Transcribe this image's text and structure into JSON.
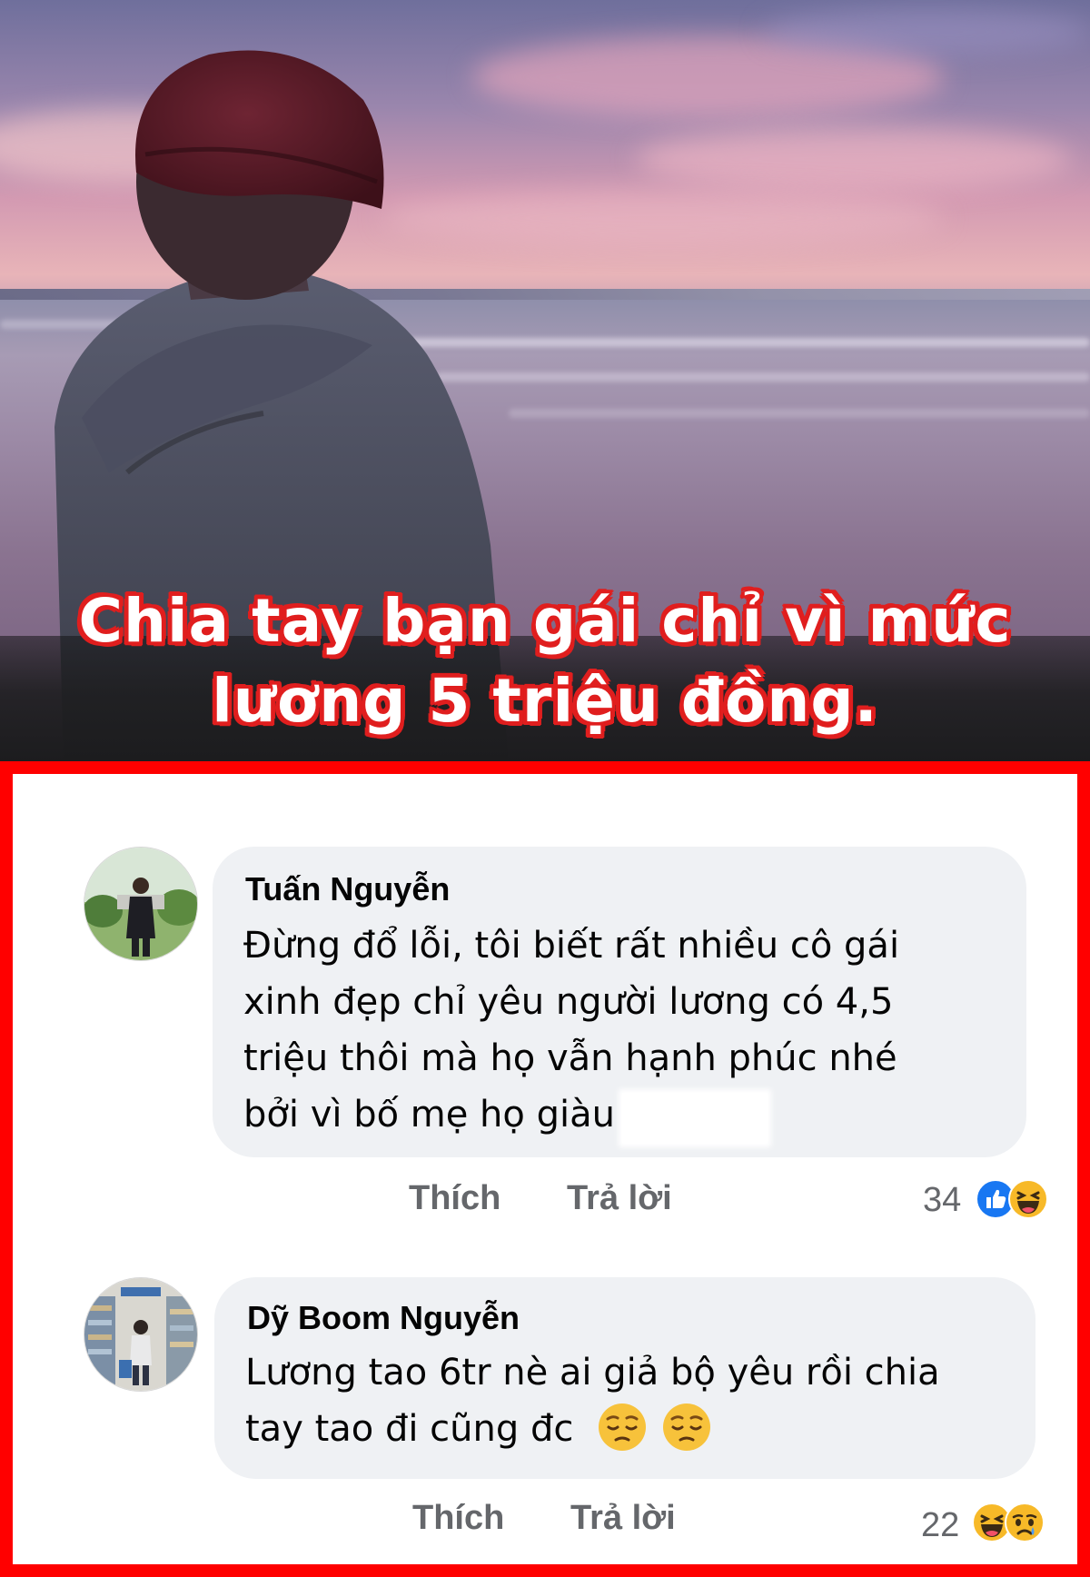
{
  "post": {
    "headline_line1": "Chia tay bạn gái chỉ vì mức",
    "headline_line2": "lương 5 triệu đồng."
  },
  "comments": [
    {
      "author": "Tuấn Nguyễn",
      "lines": [
        "Đừng đổ lỗi, tôi biết rất nhiều cô gái",
        "xinh đẹp chỉ yêu người lương có 4,5",
        "triệu thôi mà họ vẫn hạnh phúc nhé",
        "bởi vì bố mẹ họ giàu"
      ],
      "like_label": "Thích",
      "reply_label": "Trả lời",
      "reaction_count": "34",
      "reactions": [
        "like-icon",
        "haha-icon"
      ]
    },
    {
      "author": "Dỹ Boom Nguyễn",
      "lines": [
        "Lương tao 6tr nè ai giả bộ yêu rồi chia",
        "tay tao đi cũng đc"
      ],
      "inline_emojis": [
        "pensive-face-icon",
        "pensive-face-icon"
      ],
      "like_label": "Thích",
      "reply_label": "Trả lời",
      "reaction_count": "22",
      "reactions": [
        "haha-icon",
        "sad-icon"
      ]
    }
  ],
  "colors": {
    "frame": "#ff0000",
    "headline_stroke": "#e01e1e",
    "bubble": "#eff1f4",
    "secondary_text": "#65676b",
    "like_blue": "#1877f2",
    "reaction_yellow": "#f7b928"
  }
}
